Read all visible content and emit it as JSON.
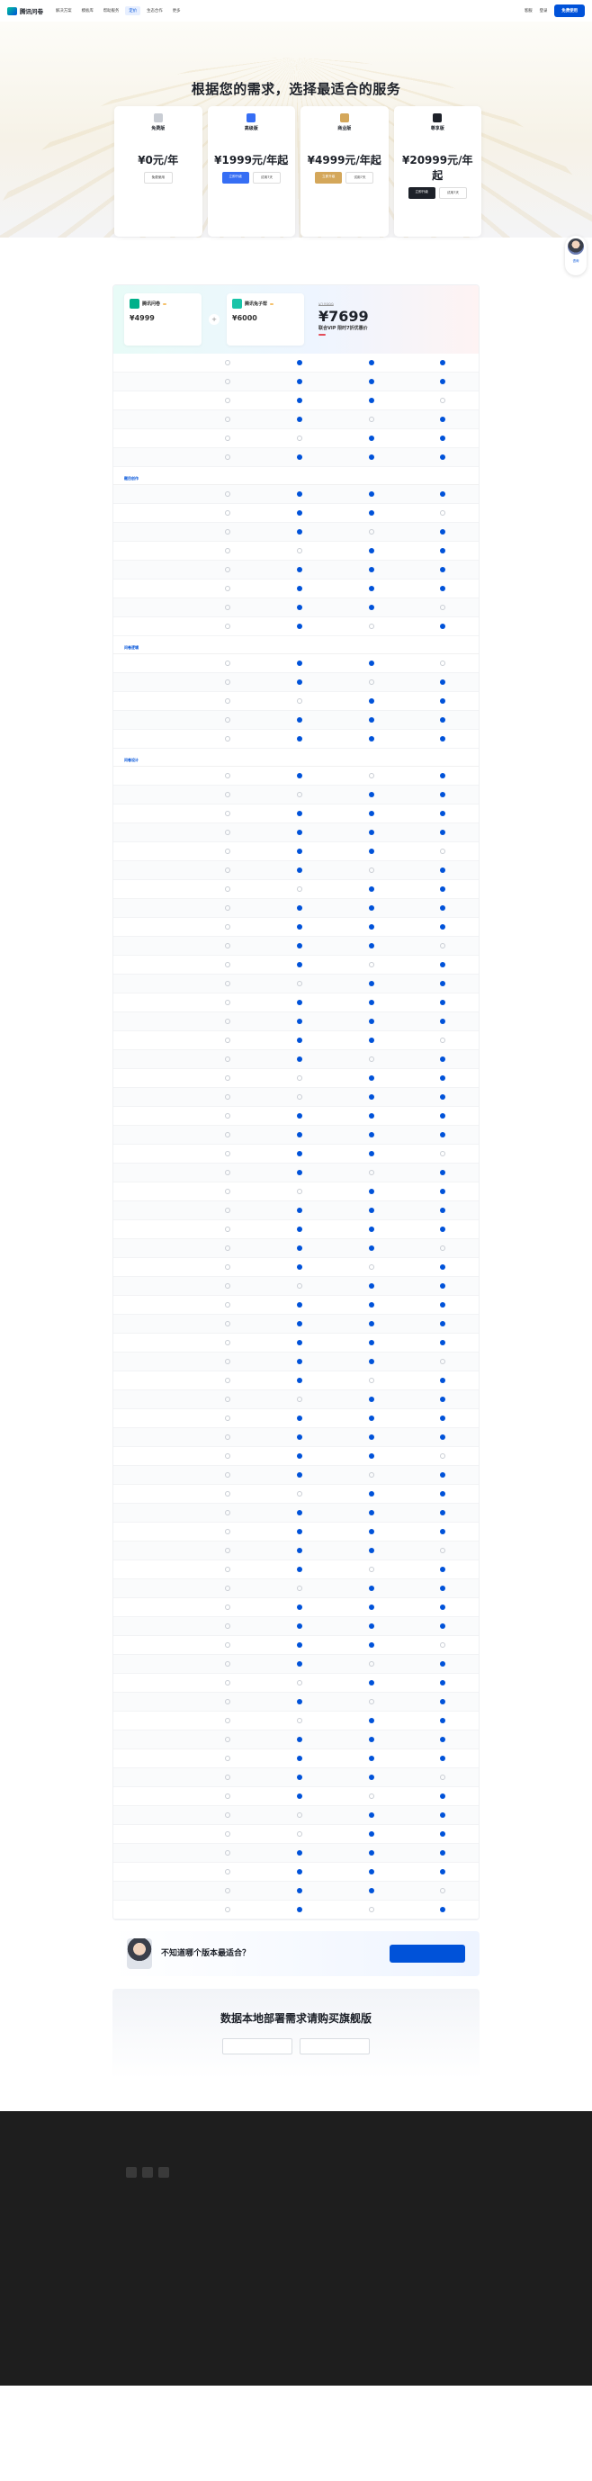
{
  "nav": {
    "logo": "腾讯问卷",
    "items": [
      "解决方案",
      "模板库",
      "帮助服务",
      "定价",
      "生态合作",
      "更多"
    ],
    "right": [
      "客服",
      "登录",
      "免费使用"
    ]
  },
  "hero": {
    "title": "根据您的需求，选择最适合的服务"
  },
  "plans": [
    {
      "name": "免费版",
      "desc": "",
      "price": "¥0元/年",
      "note": "",
      "btn": "免费使用",
      "color": "#c9cdd4"
    },
    {
      "name": "高级版",
      "desc": "",
      "price": "¥1999元/年起",
      "note": "",
      "btn": "立即升级",
      "btn2": "试用7天",
      "link": "",
      "color": "#366ef4"
    },
    {
      "name": "商业版",
      "desc": "",
      "price": "¥4999元/年起",
      "note": "",
      "btn": "立即升级",
      "btn2": "试用7天",
      "link": "",
      "color": "#d4a75a"
    },
    {
      "name": "尊享版",
      "desc": "",
      "price": "¥20999元/年起",
      "note": "",
      "btn": "立即升级",
      "btn2": "试用7天",
      "link": "",
      "color": "#1d2129"
    }
  ],
  "plan_toggle": [],
  "float": {
    "label": "咨询"
  },
  "banner": {
    "p1": {
      "name": "腾讯问卷",
      "tag": "",
      "price": "¥4999"
    },
    "p2": {
      "name": "腾讯兔子帮",
      "tag": "",
      "price": "¥6000"
    },
    "old": "¥10999",
    "price": "¥7699",
    "sub": "联合VIP 限时7折优惠价",
    "tag": "",
    "stamp": ""
  },
  "sections": [
    {
      "title": "",
      "rows": [
        [
          ""
        ],
        [
          ""
        ],
        [
          ""
        ],
        [
          ""
        ],
        [
          ""
        ],
        [
          ""
        ]
      ]
    },
    {
      "title": "题目创作",
      "rows": [
        [
          ""
        ],
        [
          ""
        ],
        [
          ""
        ],
        [
          ""
        ],
        [
          ""
        ],
        [
          ""
        ],
        [
          ""
        ],
        [
          ""
        ]
      ]
    },
    {
      "title": "问卷逻辑",
      "rows": [
        [
          ""
        ],
        [
          ""
        ],
        [
          ""
        ],
        [
          ""
        ],
        [
          ""
        ]
      ]
    },
    {
      "title": "问卷设计",
      "rows": [
        [
          ""
        ],
        [
          ""
        ],
        [
          ""
        ],
        [
          ""
        ],
        [
          ""
        ],
        [
          ""
        ],
        [
          ""
        ],
        [
          ""
        ],
        [
          ""
        ],
        [
          ""
        ],
        [
          ""
        ],
        [
          ""
        ],
        [
          ""
        ],
        [
          ""
        ],
        [
          ""
        ],
        [
          ""
        ],
        [
          ""
        ]
      ]
    },
    {
      "title": "",
      "rows": [
        [
          ""
        ],
        [
          ""
        ],
        [
          ""
        ],
        [
          ""
        ],
        [
          ""
        ],
        [
          ""
        ],
        [
          ""
        ],
        [
          ""
        ],
        [
          ""
        ],
        [
          ""
        ],
        [
          ""
        ],
        [
          ""
        ]
      ]
    },
    {
      "title": "",
      "rows": [
        [
          ""
        ],
        [
          ""
        ],
        [
          ""
        ],
        [
          ""
        ],
        [
          ""
        ],
        [
          ""
        ]
      ]
    },
    {
      "title": "",
      "rows": [
        [
          ""
        ],
        [
          ""
        ],
        [
          ""
        ],
        [
          ""
        ],
        [
          ""
        ],
        [
          ""
        ]
      ]
    },
    {
      "title": "",
      "rows": [
        [
          ""
        ],
        [
          ""
        ],
        [
          ""
        ],
        [
          ""
        ],
        [
          ""
        ],
        [
          ""
        ],
        [
          ""
        ],
        [
          ""
        ]
      ]
    },
    {
      "title": "",
      "rows": [
        [
          ""
        ],
        [
          ""
        ],
        [
          ""
        ],
        [
          ""
        ],
        [
          ""
        ],
        [
          ""
        ],
        [
          ""
        ]
      ]
    },
    {
      "title": "",
      "rows": [
        [
          ""
        ],
        [
          ""
        ],
        [
          ""
        ],
        [
          ""
        ],
        [
          ""
        ]
      ]
    }
  ],
  "cta": {
    "title": "不知道哪个版本最适合？",
    "sub": "",
    "btn": ""
  },
  "private": {
    "title": "数据本地部署需求请购买旗舰版",
    "btn1": "",
    "btn2": ""
  },
  "footer": {
    "cols": [
      {
        "title": "",
        "items": [
          ""
        ]
      },
      {
        "title": "",
        "items": [
          ""
        ]
      },
      {
        "title": "",
        "items": [
          ""
        ]
      },
      {
        "title": "",
        "items": [
          ""
        ]
      },
      {
        "title": "",
        "items": [
          ""
        ]
      }
    ],
    "copyright": ""
  }
}
